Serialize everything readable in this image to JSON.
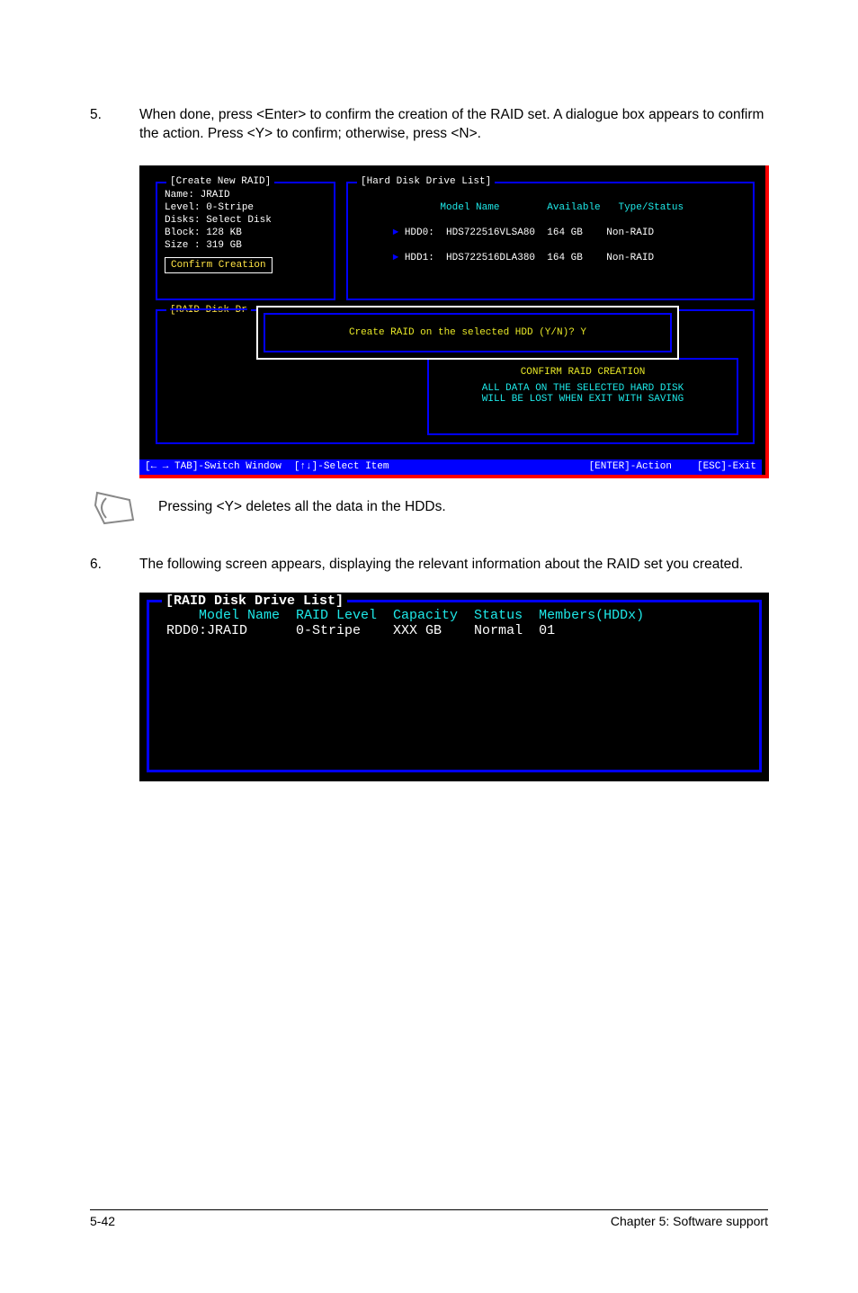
{
  "step5": {
    "num": "5.",
    "text": "When done, press <Enter> to confirm the creation of the RAID set. A dialogue box appears to confirm the action. Press <Y> to confirm; otherwise, press <N>."
  },
  "console1": {
    "create_title": "[Create New RAID]",
    "create_body": "Name: JRAID\nLevel: 0-Stripe\nDisks: Select Disk\nBlock: 128 KB\nSize : 319 GB",
    "confirm_creation": "Confirm Creation",
    "hard_title": "[Hard Disk Drive List]",
    "hard_header_model": "Model Name",
    "hard_header_avail": "Available",
    "hard_header_type": "Type/Status",
    "hdd0": "HDD0:  HDS722516VLSA80  164 GB    Non-RAID",
    "hdd1": "HDD1:  HDS722516DLA380  164 GB    Non-RAID",
    "raid_list_title": "[RAID Disk Dr",
    "dialog_inner": "Create RAID on the selected HDD (Y/N)? Y",
    "msg_title": "CONFIRM RAID CREATION",
    "msg_line1": "ALL DATA ON THE SELECTED HARD DISK",
    "msg_line2": "WILL BE LOST WHEN EXIT WITH SAVING",
    "hint_tab": "TAB]-Switch Window",
    "hint_sel": "[↑↓]-Select Item",
    "hint_enter": "[ENTER]-Action",
    "hint_esc": "[ESC]-Exit"
  },
  "note_text": "Pressing <Y> deletes all the data in the HDDs.",
  "step6": {
    "num": "6.",
    "text": "The following screen appears, displaying the relevant information about the RAID set you created."
  },
  "console2": {
    "title": "[RAID Disk Drive List]",
    "header": "     Model Name  RAID Level  Capacity  Status  Members(HDDx)",
    "row": " RDD0:JRAID      0-Stripe    XXX GB    Normal  01"
  },
  "footer_left": "5-42",
  "footer_right": "Chapter 5: Software support"
}
